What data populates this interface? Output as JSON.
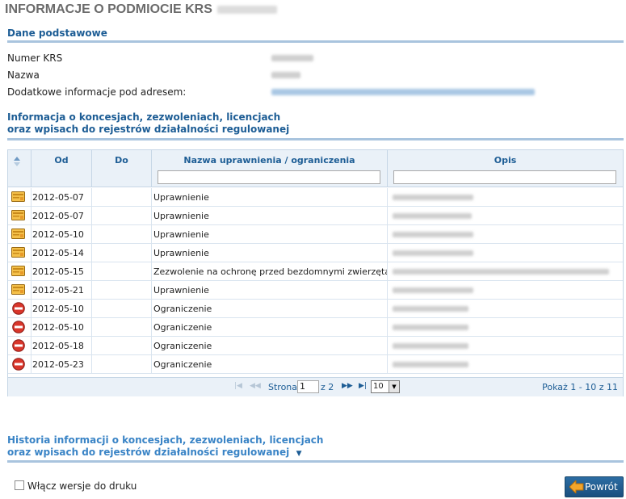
{
  "page": {
    "title": "INFORMACJE O PODMIOCIE KRS"
  },
  "basic": {
    "heading": "Dane podstawowe",
    "krs_label": "Numer KRS",
    "name_label": "Nazwa",
    "extra_label": "Dodatkowe informacje pod adresem:"
  },
  "concessions": {
    "heading_line1": "Informacja o koncesjach, zezwoleniach, licencjach",
    "heading_line2": "oraz wpisach do rejestrów działalności regulowanej",
    "columns": [
      "Od",
      "Do",
      "Nazwa uprawnienia / ograniczenia",
      "Opis"
    ],
    "rows": [
      {
        "icon": "permit-icon",
        "od": "2012-05-07",
        "do": "",
        "nazwa": "Uprawnienie"
      },
      {
        "icon": "permit-icon",
        "od": "2012-05-07",
        "do": "",
        "nazwa": "Uprawnienie"
      },
      {
        "icon": "permit-icon",
        "od": "2012-05-10",
        "do": "",
        "nazwa": "Uprawnienie"
      },
      {
        "icon": "permit-icon",
        "od": "2012-05-14",
        "do": "",
        "nazwa": "Uprawnienie"
      },
      {
        "icon": "permit-icon",
        "od": "2012-05-15",
        "do": "",
        "nazwa": "Zezwolenie na ochronę przed bezdomnymi zwierzętami"
      },
      {
        "icon": "permit-icon",
        "od": "2012-05-21",
        "do": "",
        "nazwa": "Uprawnienie"
      },
      {
        "icon": "restriction-icon",
        "od": "2012-05-10",
        "do": "",
        "nazwa": "Ograniczenie"
      },
      {
        "icon": "restriction-icon",
        "od": "2012-05-10",
        "do": "",
        "nazwa": "Ograniczenie"
      },
      {
        "icon": "restriction-icon",
        "od": "2012-05-18",
        "do": "",
        "nazwa": "Ograniczenie"
      },
      {
        "icon": "restriction-icon",
        "od": "2012-05-23",
        "do": "",
        "nazwa": "Ograniczenie"
      }
    ],
    "pager": {
      "page_label": "Strona",
      "page_value": "1",
      "of_label": "z 2",
      "rows_per_page": "10",
      "info": "Pokaż 1 - 10 z 11"
    }
  },
  "history": {
    "line1": "Historia informacji o koncesjach, zezwoleniach, licencjach",
    "line2": "oraz wpisach do rejestrów działalności regulowanej",
    "toggle_glyph": "▼"
  },
  "footer": {
    "print_label": "Włącz wersje do druku",
    "back_label": "Powrót"
  },
  "colors": {
    "accent": "#1d5d95",
    "header_bg": "#eaf1f8",
    "rule": "#a9c4de",
    "button": "#1f5a8b"
  }
}
